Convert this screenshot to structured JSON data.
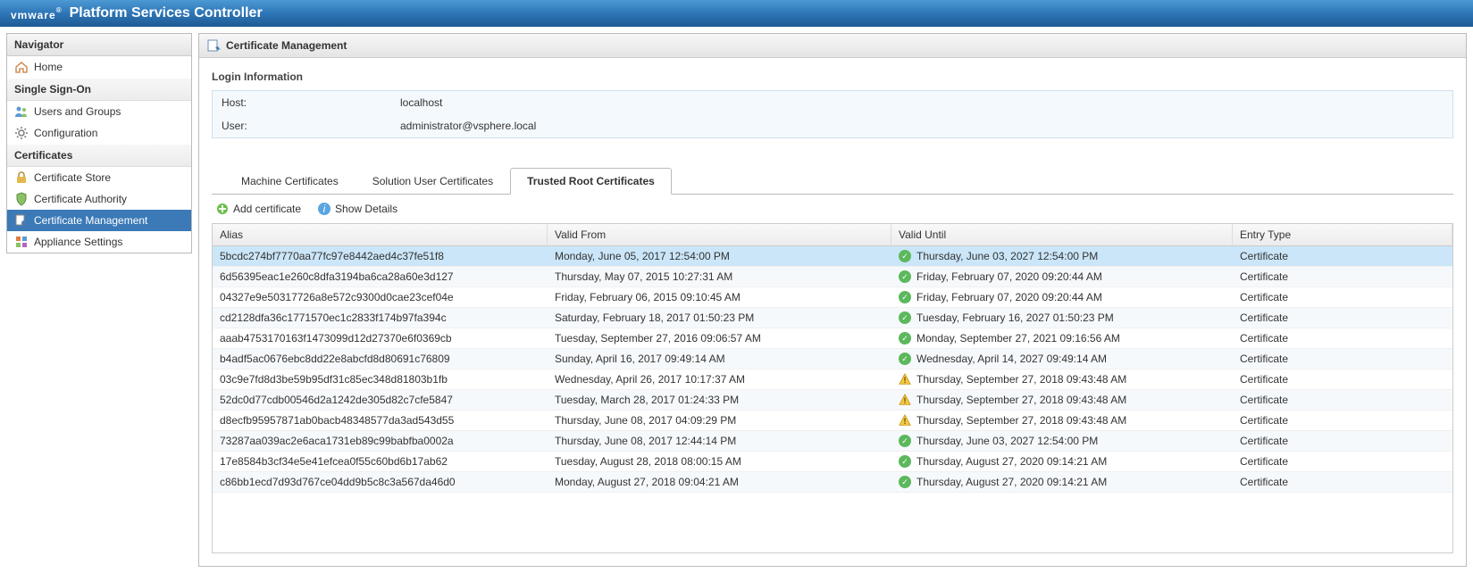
{
  "brand": "vmware",
  "app_title": "Platform Services Controller",
  "navigator": {
    "title": "Navigator",
    "home": "Home",
    "sections": [
      {
        "label": "Single Sign-On",
        "items": [
          {
            "id": "users-groups",
            "label": "Users and Groups",
            "icon": "users-icon",
            "active": false
          },
          {
            "id": "configuration",
            "label": "Configuration",
            "icon": "gear-icon",
            "active": false
          }
        ]
      },
      {
        "label": "Certificates",
        "items": [
          {
            "id": "cert-store",
            "label": "Certificate Store",
            "icon": "lock-icon",
            "active": false
          },
          {
            "id": "cert-authority",
            "label": "Certificate Authority",
            "icon": "shield-icon",
            "active": false
          },
          {
            "id": "cert-mgmt",
            "label": "Certificate Management",
            "icon": "cert-icon",
            "active": true
          },
          {
            "id": "appliance",
            "label": "Appliance Settings",
            "icon": "grid-icon",
            "active": false
          }
        ]
      }
    ]
  },
  "page": {
    "title": "Certificate Management",
    "login_info_label": "Login Information",
    "host_label": "Host:",
    "host_value": "localhost",
    "user_label": "User:",
    "user_value": "administrator@vsphere.local",
    "tabs": [
      {
        "label": "Machine Certificates",
        "active": false
      },
      {
        "label": "Solution User Certificates",
        "active": false
      },
      {
        "label": "Trusted Root Certificates",
        "active": true
      }
    ],
    "add_cert_label": "Add certificate",
    "show_details_label": "Show Details",
    "columns": {
      "alias": "Alias",
      "from": "Valid From",
      "until": "Valid Until",
      "type": "Entry Type"
    },
    "rows": [
      {
        "alias": "5bcdc274bf7770aa77fc97e8442aed4c37fe51f8",
        "from": "Monday, June 05, 2017 12:54:00 PM",
        "until": "Thursday, June 03, 2027 12:54:00 PM",
        "status": "ok",
        "type": "Certificate",
        "selected": true
      },
      {
        "alias": "6d56395eac1e260c8dfa3194ba6ca28a60e3d127",
        "from": "Thursday, May 07, 2015 10:27:31 AM",
        "until": "Friday, February 07, 2020 09:20:44 AM",
        "status": "ok",
        "type": "Certificate"
      },
      {
        "alias": "04327e9e50317726a8e572c9300d0cae23cef04e",
        "from": "Friday, February 06, 2015 09:10:45 AM",
        "until": "Friday, February 07, 2020 09:20:44 AM",
        "status": "ok",
        "type": "Certificate"
      },
      {
        "alias": "cd2128dfa36c1771570ec1c2833f174b97fa394c",
        "from": "Saturday, February 18, 2017 01:50:23 PM",
        "until": "Tuesday, February 16, 2027 01:50:23 PM",
        "status": "ok",
        "type": "Certificate"
      },
      {
        "alias": "aaab4753170163f1473099d12d27370e6f0369cb",
        "from": "Tuesday, September 27, 2016 09:06:57 AM",
        "until": "Monday, September 27, 2021 09:16:56 AM",
        "status": "ok",
        "type": "Certificate"
      },
      {
        "alias": "b4adf5ac0676ebc8dd22e8abcfd8d80691c76809",
        "from": "Sunday, April 16, 2017 09:49:14 AM",
        "until": "Wednesday, April 14, 2027 09:49:14 AM",
        "status": "ok",
        "type": "Certificate"
      },
      {
        "alias": "03c9e7fd8d3be59b95df31c85ec348d81803b1fb",
        "from": "Wednesday, April 26, 2017 10:17:37 AM",
        "until": "Thursday, September 27, 2018 09:43:48 AM",
        "status": "warn",
        "type": "Certificate"
      },
      {
        "alias": "52dc0d77cdb00546d2a1242de305d82c7cfe5847",
        "from": "Tuesday, March 28, 2017 01:24:33 PM",
        "until": "Thursday, September 27, 2018 09:43:48 AM",
        "status": "warn",
        "type": "Certificate"
      },
      {
        "alias": "d8ecfb95957871ab0bacb48348577da3ad543d55",
        "from": "Thursday, June 08, 2017 04:09:29 PM",
        "until": "Thursday, September 27, 2018 09:43:48 AM",
        "status": "warn",
        "type": "Certificate"
      },
      {
        "alias": "73287aa039ac2e6aca1731eb89c99babfba0002a",
        "from": "Thursday, June 08, 2017 12:44:14 PM",
        "until": "Thursday, June 03, 2027 12:54:00 PM",
        "status": "ok",
        "type": "Certificate"
      },
      {
        "alias": "17e8584b3cf34e5e41efcea0f55c60bd6b17ab62",
        "from": "Tuesday, August 28, 2018 08:00:15 AM",
        "until": "Thursday, August 27, 2020 09:14:21 AM",
        "status": "ok",
        "type": "Certificate"
      },
      {
        "alias": "c86bb1ecd7d93d767ce04dd9b5c8c3a567da46d0",
        "from": "Monday, August 27, 2018 09:04:21 AM",
        "until": "Thursday, August 27, 2020 09:14:21 AM",
        "status": "ok",
        "type": "Certificate"
      }
    ]
  }
}
